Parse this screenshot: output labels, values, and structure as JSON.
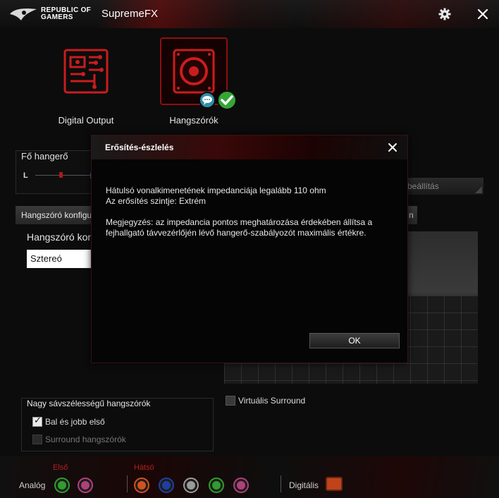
{
  "titlebar": {
    "brand_line1": "REPUBLIC OF",
    "brand_line2": "GAMERS",
    "app_title": "SupremeFX"
  },
  "devices": [
    {
      "label": "Digital Output",
      "selected": false
    },
    {
      "label": "Hangszórók",
      "selected": true
    }
  ],
  "volume": {
    "title": "Fő hangerő",
    "left_label": "L"
  },
  "reset_button": "tt beállítás",
  "tabs": {
    "speaker_config": "Hangszóró konfigu",
    "right_partial": "n"
  },
  "speaker_config": {
    "label": "Hangszóró konfig",
    "selected_value": "Sztereó"
  },
  "virtual_surround": {
    "label": "Virtuális Surround",
    "checked": false
  },
  "wideband": {
    "title": "Nagy sávszélességű hangszórók",
    "options": [
      {
        "label": "Bal és jobb első",
        "checked": true,
        "enabled": true
      },
      {
        "label": "Surround hangszórók",
        "checked": false,
        "enabled": false
      }
    ]
  },
  "jacks": {
    "analog_label": "Analóg",
    "front_label": "Első",
    "rear_label": "Hátsó",
    "digital_label": "Digitális",
    "front_colors": [
      "#2e9e2e",
      "#b0407a"
    ],
    "rear_colors": [
      "#d0521c",
      "#1f3fa0",
      "#9a9a9a",
      "#2e9e2e",
      "#b0407a"
    ]
  },
  "dialog": {
    "title": "Erősítés-észlelés",
    "line1": "Hátulsó vonalkimenetének impedanciája legalább 110 ohm",
    "line2": "Az erősítés szintje: Extrém",
    "note": "Megjegyzés: az impedancia pontos meghatározása érdekében állítsa a fejhallgató távvezérlőjén lévő hangerő-szabályozót maximális értékre.",
    "ok_label": "OK"
  },
  "colors": {
    "accent_red": "#b01818",
    "ok_green": "#35a535"
  }
}
